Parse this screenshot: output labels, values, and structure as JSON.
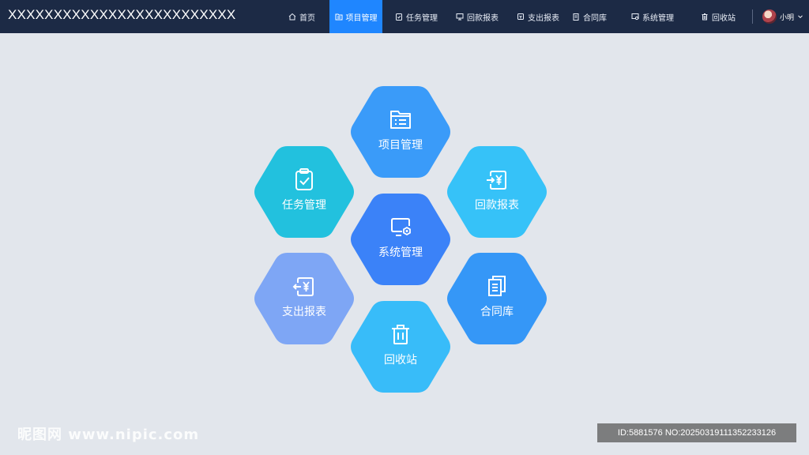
{
  "app": {
    "title": "XXXXXXXXXXXXXXXXXXXXXXXXX"
  },
  "nav": {
    "items": [
      {
        "label": "首页",
        "icon": "home-icon"
      },
      {
        "label": "项目管理",
        "icon": "folder-list-icon",
        "active": true
      },
      {
        "label": "任务管理",
        "icon": "clipboard-check-icon"
      },
      {
        "label": "回款报表",
        "icon": "monitor-report-icon"
      },
      {
        "label": "支出报表",
        "icon": "payment-out-icon"
      },
      {
        "label": "合同库",
        "icon": "document-stack-icon"
      },
      {
        "label": "系统管理",
        "icon": "monitor-gear-icon"
      },
      {
        "label": "回收站",
        "icon": "trash-icon"
      }
    ],
    "active_color": "#1f86ff"
  },
  "user": {
    "name": "小明"
  },
  "tiles": {
    "project": {
      "label": "项目管理",
      "icon": "folder-list-icon",
      "color": "#3a9bf9"
    },
    "task": {
      "label": "任务管理",
      "icon": "clipboard-check-icon",
      "color": "#22c1de"
    },
    "payment": {
      "label": "回款报表",
      "icon": "payment-in-icon",
      "color": "#36c2f8"
    },
    "system": {
      "label": "系统管理",
      "icon": "monitor-gear-icon",
      "color": "#3b82f8"
    },
    "expense": {
      "label": "支出报表",
      "icon": "payment-out-icon",
      "color": "#7ea6f5"
    },
    "contract": {
      "label": "合同库",
      "icon": "document-stack-icon",
      "color": "#3597f7"
    },
    "recycle": {
      "label": "回收站",
      "icon": "trash-icon",
      "color": "#38bcf9"
    }
  },
  "watermark": {
    "left": "昵图网 www.nipic.com",
    "right": "ID:5881576 NO:20250319111352233126"
  }
}
